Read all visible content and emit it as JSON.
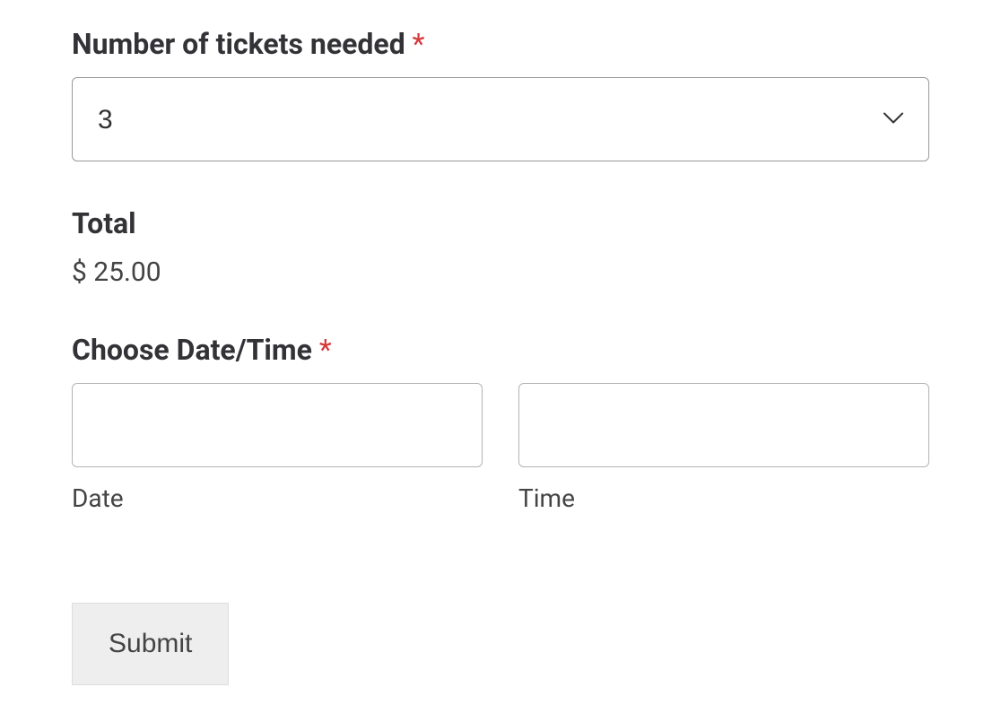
{
  "tickets": {
    "label": "Number of tickets needed",
    "required_marker": "*",
    "value": "3"
  },
  "total": {
    "label": "Total",
    "value": "$ 25.00"
  },
  "datetime": {
    "label": "Choose Date/Time",
    "required_marker": "*",
    "date_label": "Date",
    "date_value": "",
    "time_label": "Time",
    "time_value": ""
  },
  "submit": {
    "label": "Submit"
  }
}
